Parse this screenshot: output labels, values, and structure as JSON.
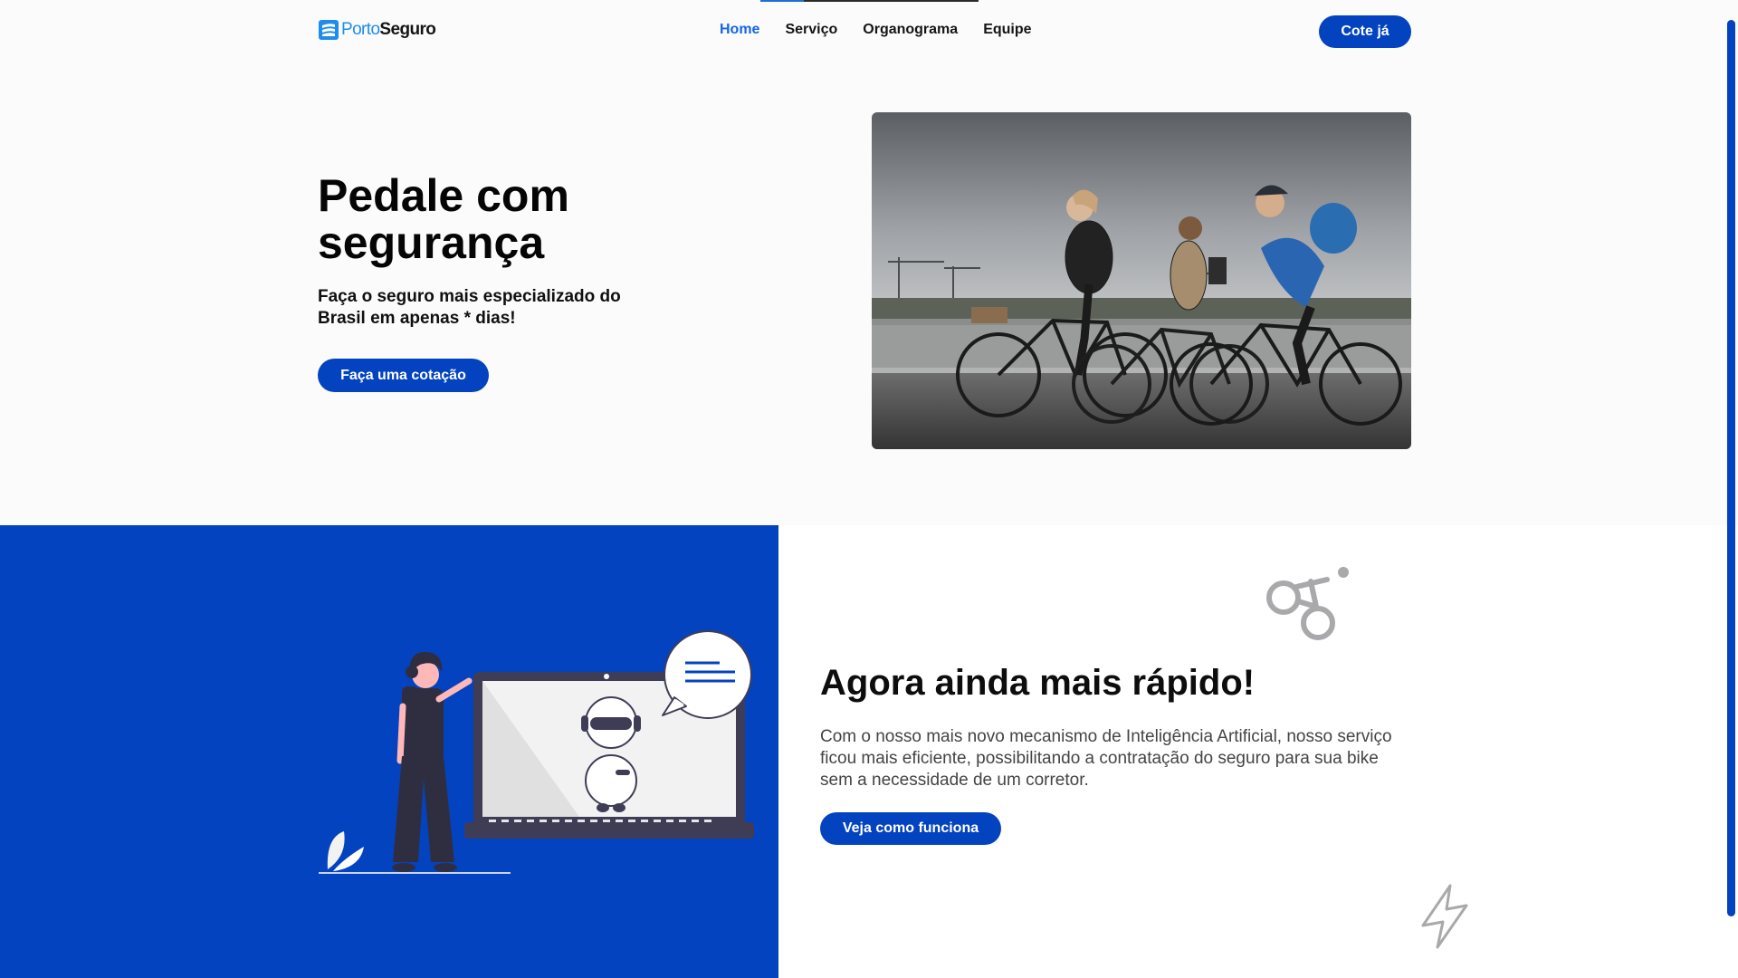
{
  "brand": {
    "name_part1": "Porto",
    "name_part2": "Seguro",
    "accent": "#1f8dee"
  },
  "nav": {
    "items": [
      {
        "label": "Home",
        "active": true
      },
      {
        "label": "Serviço",
        "active": false
      },
      {
        "label": "Organograma",
        "active": false
      },
      {
        "label": "Equipe",
        "active": false
      }
    ],
    "cta_label": "Cote já"
  },
  "hero": {
    "title": "Pedale com segurança",
    "subtitle": "Faça o seguro mais especializado do Brasil em apenas * dias!",
    "cta_label": "Faça uma cotação"
  },
  "feature": {
    "title": "Agora ainda mais rápido!",
    "text": "Com o nosso mais novo mecanismo de Inteligência Artificial, nosso serviço ficou mais eficiente, possibilitando a contratação do seguro para sua bike sem a necessidade de um corretor.",
    "cta_label": "Veja como funciona",
    "icons": [
      "bike-icon",
      "lightning-icon"
    ]
  },
  "colors": {
    "primary": "#0443bf",
    "nav_active": "#1565e6",
    "background": "#fafbfa"
  }
}
